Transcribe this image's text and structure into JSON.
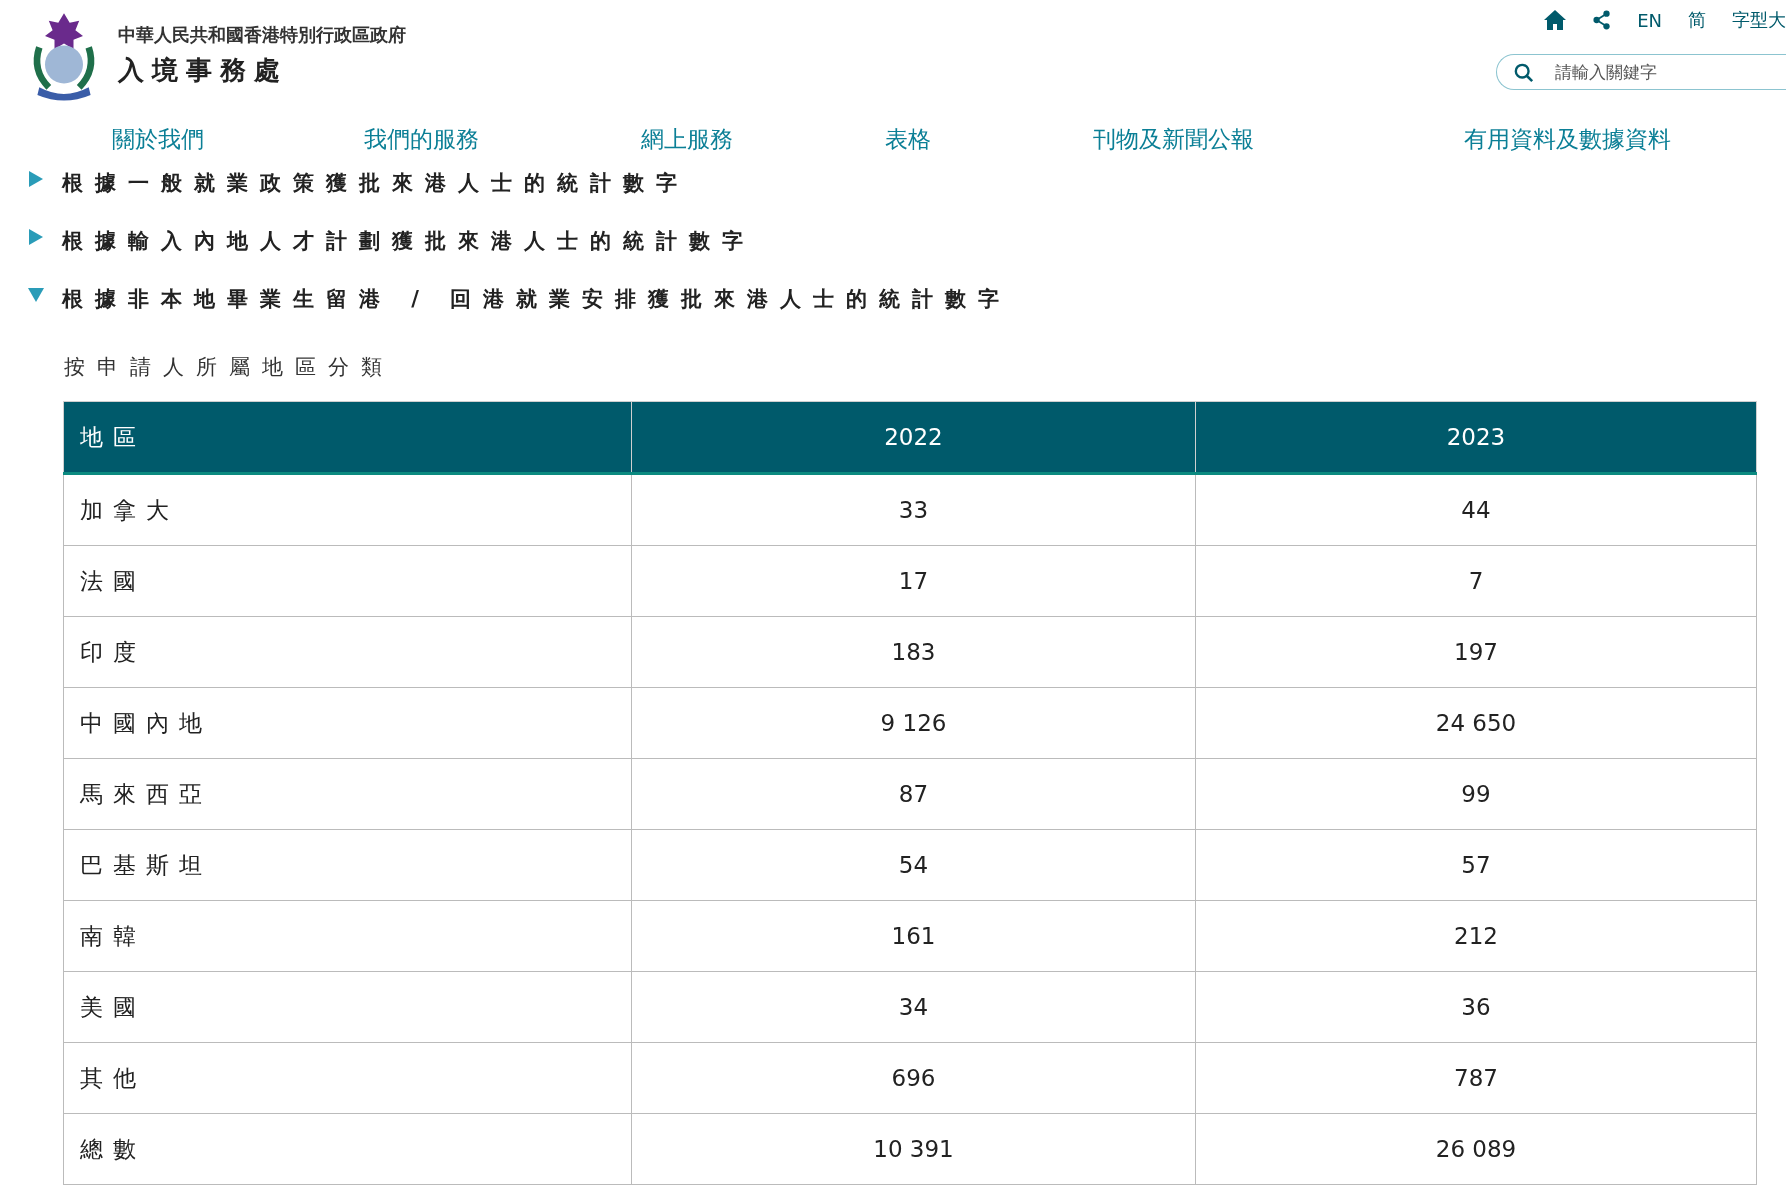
{
  "header": {
    "gov_name": "中華人民共和國香港特別行政區政府",
    "dept_name": "入境事務處",
    "links": [
      {
        "kind": "home"
      },
      {
        "kind": "share"
      },
      {
        "kind": "text",
        "label": "EN"
      },
      {
        "kind": "text",
        "label": "简"
      },
      {
        "kind": "text",
        "label": "字型大"
      }
    ],
    "search": {
      "placeholder": "請輸入關鍵字"
    }
  },
  "nav": [
    "關於我們",
    "我們的服務",
    "網上服務",
    "表格",
    "刊物及新聞公報",
    "有用資料及數據資料"
  ],
  "sections": [
    {
      "title": "根據一般就業政策獲批來港人士的統計數字",
      "expanded": false
    },
    {
      "title": "根據輸入內地人才計劃獲批來港人士的統計數字",
      "expanded": false
    },
    {
      "title": "根據非本地畢業生留港 / 回港就業安排獲批來港人士的統計數字",
      "expanded": true
    }
  ],
  "table": {
    "caption": "按申請人所屬地區分類",
    "columns": [
      "地區",
      "2022",
      "2023"
    ],
    "rows": [
      [
        "加拿大",
        "33",
        "44"
      ],
      [
        "法國",
        "17",
        "7"
      ],
      [
        "印度",
        "183",
        "197"
      ],
      [
        "中國內地",
        "9 126",
        "24 650"
      ],
      [
        "馬來西亞",
        "87",
        "99"
      ],
      [
        "巴基斯坦",
        "54",
        "57"
      ],
      [
        "南韓",
        "161",
        "212"
      ],
      [
        "美國",
        "34",
        "36"
      ],
      [
        "其他",
        "696",
        "787"
      ],
      [
        "總數",
        "10 391",
        "26 089"
      ]
    ]
  }
}
